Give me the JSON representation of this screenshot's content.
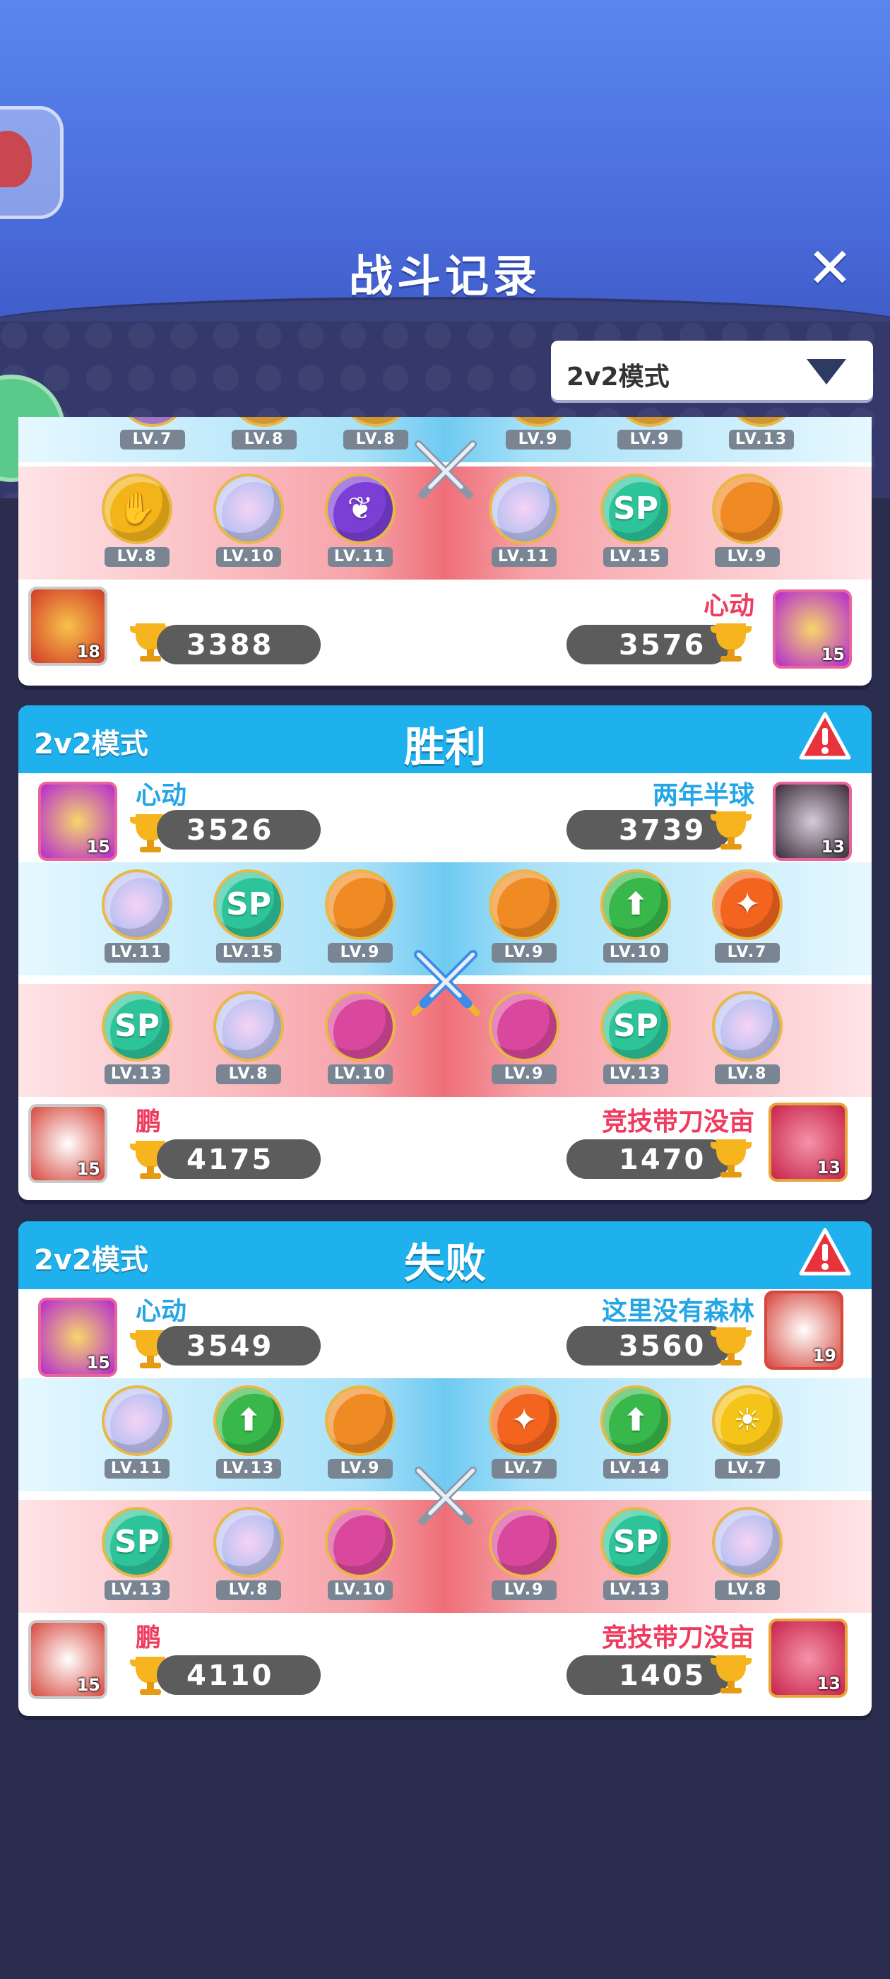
{
  "header": {
    "title": "战斗记录",
    "close_icon": "close-icon"
  },
  "mode_filter": {
    "selected": "2v2模式"
  },
  "colors": {
    "header_blue": "#1fb1ee",
    "name_blue": "#24a6e6",
    "name_red": "#ee3b5e",
    "pill": "#5c5c5c"
  },
  "cards": [
    {
      "mode": "",
      "result": "",
      "top_team": [],
      "blue_pets": [
        "LV.7",
        "LV.8",
        "LV.8",
        "LV.9",
        "LV.9",
        "LV.13"
      ],
      "red_pets": [
        "LV.8",
        "LV.10",
        "LV.11",
        "LV.11",
        "LV.15",
        "LV.9"
      ],
      "bottom_left": {
        "name": "",
        "score": "3388",
        "avatar_level": "18"
      },
      "bottom_right": {
        "name": "心动",
        "score": "3576",
        "avatar_level": "15"
      }
    },
    {
      "mode": "2v2模式",
      "result": "胜利",
      "top_left": {
        "name": "心动",
        "score": "3526",
        "avatar_level": "15"
      },
      "top_right": {
        "name": "两年半球",
        "score": "3739",
        "avatar_level": "13"
      },
      "blue_pets": [
        "LV.11",
        "LV.15",
        "LV.9",
        "LV.9",
        "LV.10",
        "LV.7"
      ],
      "red_pets": [
        "LV.13",
        "LV.8",
        "LV.10",
        "LV.9",
        "LV.13",
        "LV.8"
      ],
      "bottom_left": {
        "name": "鹏",
        "score": "4175",
        "avatar_level": "15"
      },
      "bottom_right": {
        "name": "竞技带刀没亩",
        "score": "1470",
        "avatar_level": "13"
      }
    },
    {
      "mode": "2v2模式",
      "result": "失败",
      "top_left": {
        "name": "心动",
        "score": "3549",
        "avatar_level": "15"
      },
      "top_right": {
        "name": "这里没有森林",
        "score": "3560",
        "avatar_level": "19"
      },
      "blue_pets": [
        "LV.11",
        "LV.13",
        "LV.9",
        "LV.7",
        "LV.14",
        "LV.7"
      ],
      "red_pets": [
        "LV.13",
        "LV.8",
        "LV.10",
        "LV.9",
        "LV.13",
        "LV.8"
      ],
      "bottom_left": {
        "name": "鹏",
        "score": "4110",
        "avatar_level": "15"
      },
      "bottom_right": {
        "name": "竞技带刀没亩",
        "score": "1405",
        "avatar_level": "13"
      }
    }
  ]
}
